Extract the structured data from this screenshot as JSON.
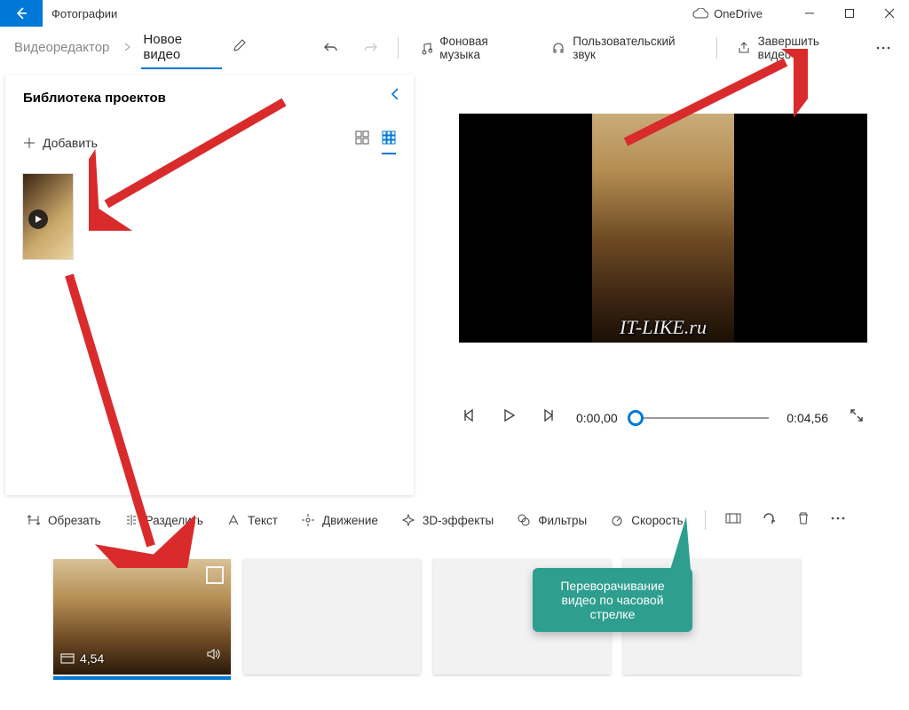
{
  "titlebar": {
    "app_name": "Фотографии",
    "onedrive": "OneDrive"
  },
  "breadcrumb": {
    "prev": "Видеоредактор",
    "current": "Новое видео"
  },
  "toolbar": {
    "bg_music": "Фоновая музыка",
    "custom_audio": "Пользовательский звук",
    "finish": "Завершить видео"
  },
  "library": {
    "title": "Библиотека проектов",
    "add": "Добавить"
  },
  "preview": {
    "watermark": "IT-LIKE.ru",
    "time_start": "0:00,00",
    "time_end": "0:04,56"
  },
  "sb": {
    "trim": "Обрезать",
    "split": "Разделить",
    "text": "Текст",
    "motion": "Движение",
    "fx3d": "3D-эффекты",
    "filters": "Фильтры",
    "speed": "Скорость"
  },
  "clip": {
    "duration": "4,54"
  },
  "callout": {
    "text": "Переворачивание видео по часовой стрелке"
  }
}
